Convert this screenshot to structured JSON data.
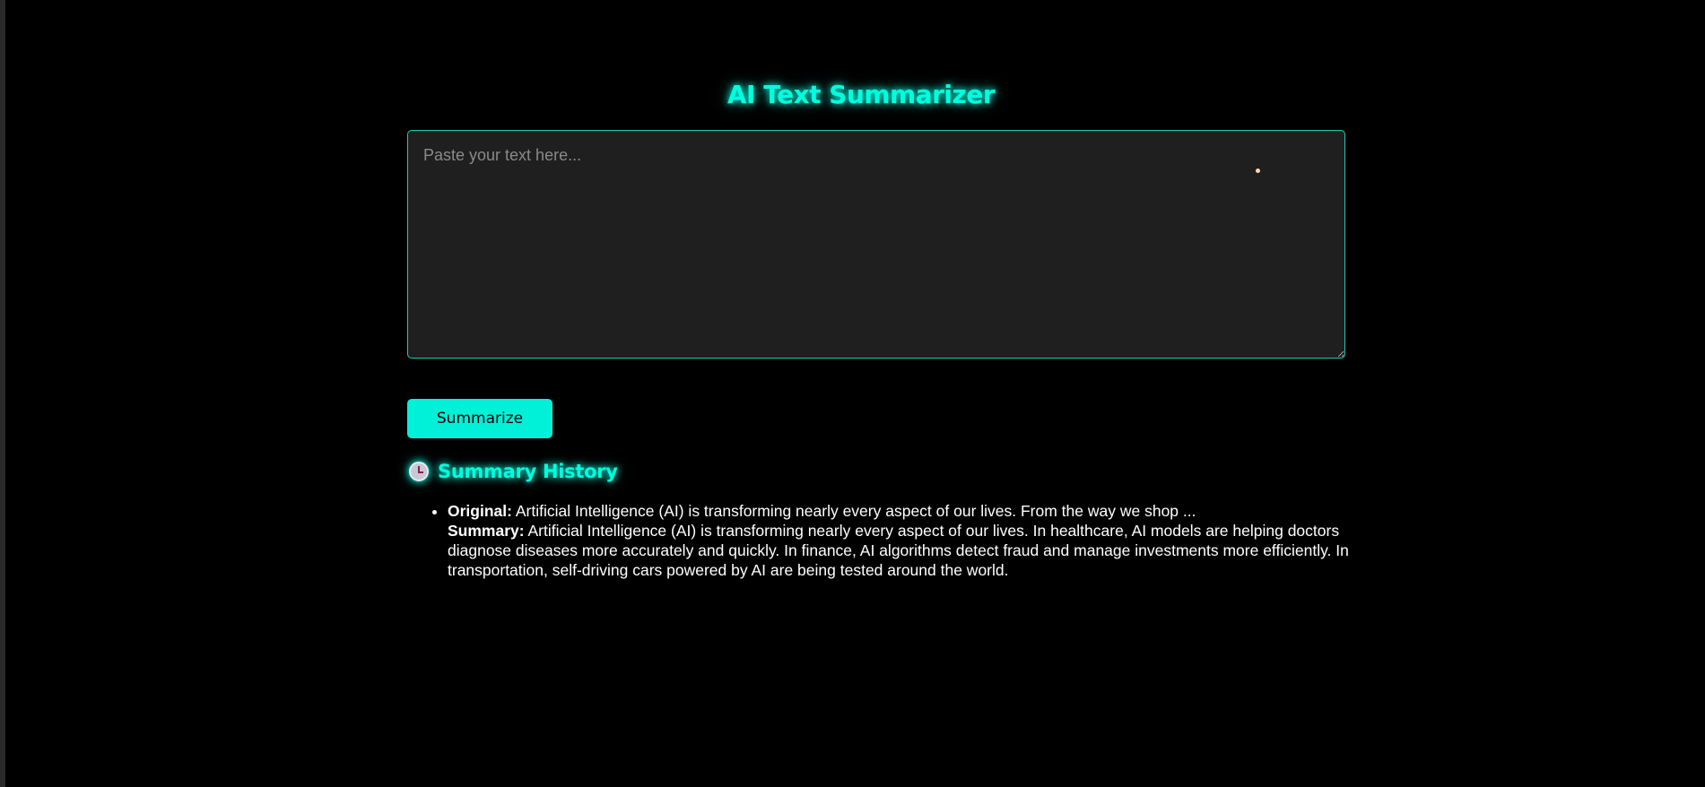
{
  "header": {
    "title": "AI Text Summarizer"
  },
  "input": {
    "placeholder": "Paste your text here...",
    "value": ""
  },
  "actions": {
    "summarize_label": "Summarize"
  },
  "history": {
    "icon": "clock-icon",
    "title": "Summary History",
    "items": [
      {
        "original_label": "Original:",
        "original_text": "Artificial Intelligence (AI) is transforming nearly every aspect of our lives. From the way we shop ...",
        "summary_label": "Summary:",
        "summary_text": "Artificial Intelligence (AI) is transforming nearly every aspect of our lives. In healthcare, AI models are helping doctors diagnose diseases more accurately and quickly. In finance, AI algorithms detect fraud and manage investments more efficiently. In transportation, self-driving cars powered by AI are being tested around the world."
      }
    ]
  },
  "colors": {
    "accent": "#00ffe0",
    "background": "#000000",
    "input_background": "#1f1f1f",
    "button": "#00f0d8"
  }
}
